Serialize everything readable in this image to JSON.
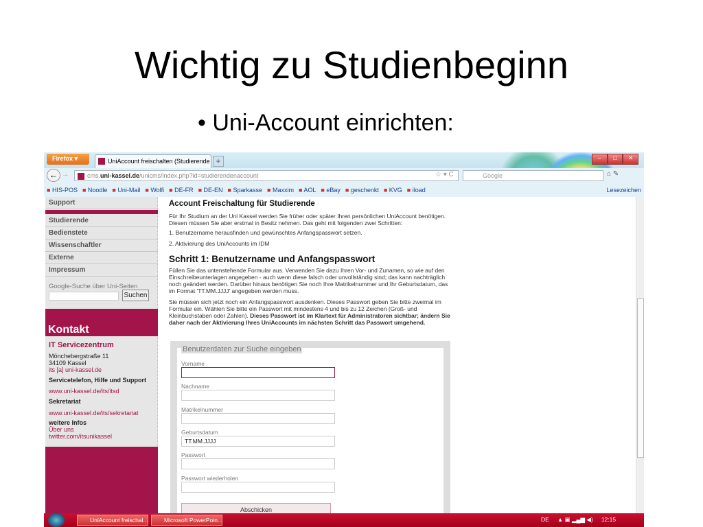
{
  "slide": {
    "title": "Wichtig zu Studienbeginn",
    "bullet": "Uni-Account einrichten:"
  },
  "browser": {
    "firefox_button": "Firefox ▾",
    "tab_title": "UniAccount freischalten (Studierende de...",
    "new_tab": "+",
    "url_prefix": "cms.",
    "url_domain": "uni-kassel.de",
    "url_path": "/unicms/index.php?id=studierendenaccount",
    "search_placeholder": "Google",
    "bookmarks": [
      "HIS-POS",
      "Noodle",
      "Uni-Mail",
      "Wolfi",
      "DE-FR",
      "DE-EN",
      "Sparkasse",
      "Maxxim",
      "AOL",
      "eBay",
      "geschenkt",
      "KVG",
      "iload"
    ],
    "bookmarks_right": "Lesezeichen"
  },
  "sidebar": {
    "items": [
      "Support",
      "Studierende",
      "Bedienstete",
      "Wissenschaftler",
      "Externe",
      "Impressum"
    ],
    "google_label": "Google-Suche über Uni-Seiten",
    "search_button": "Suchen",
    "kontakt": "Kontakt",
    "org": "IT Servicezentrum",
    "street": "Mönchebergstraße 11",
    "city": "34109 Kassel",
    "email": "its [a] uni-kassel.de",
    "service_heading": "Servicetelefon, Hilfe und Support",
    "service_link": "www.uni-kassel.de/its/itsd",
    "sekretariat_heading": "Sekretariat",
    "sekretariat_link": "www.uni-kassel.de/its/sekretariat",
    "infos_heading": "weitere Infos",
    "about_link": "Über uns",
    "twitter_link": "twitter.com/itsunikassel"
  },
  "main": {
    "heading": "Account Freischaltung für Studierende",
    "intro": "Für Ihr Studium an der Uni Kassel werden Sie früher oder später Ihren persönlichen UniAccount benötigen. Diesen müssen Sie aber erstmal in Besitz nehmen. Das geht mit folgenden zwei Schritten:",
    "steps": [
      "1.  Benutzername herausfinden und gewünschtes Anfangspasswort setzen.",
      "2.  Aktivierung des UniAccounts im IDM"
    ],
    "step1_heading": "Schritt 1: Benutzername und Anfangspasswort",
    "para1": "Füllen Sie das untenstehende Formular aus. Verwenden Sie dazu Ihren Vor- und Zunamen, so wie auf den Einschreibeunterlagen angegeben - auch wenn diese falsch oder unvollständig sind; das kann nachträglich noch geändert werden. Darüber hinaus benötigen Sie noch Ihre Matrikelnummer und Ihr Geburtsdatum, das im Format 'TT.MM.JJJJ' angegeben werden muss.",
    "para2": "Sie müssen sich jetzt noch ein Anfangspasswort ausdenken. Dieses Passwort geben Sie bitte zweimal im Formular ein. Wählen Sie bitte ein Passwort mit mindestens 4 und bis zu 12 Zeichen (Groß- und Kleinbuchstaben oder Zahlen). ",
    "para2_bold": "Dieses Passwort ist im Klartext für Administratoren sichtbar; ändern Sie daher nach der Aktivierung Ihres UniAccounts im nächsten Schritt das Passwort umgehend."
  },
  "form": {
    "legend": "Benutzerdaten zur Suche eingeben",
    "fields": [
      {
        "label": "Vorname",
        "value": ""
      },
      {
        "label": "Nachname",
        "value": ""
      },
      {
        "label": "Matrikelnummer",
        "value": ""
      },
      {
        "label": "Geburtsdatum",
        "value": "TT.MM.JJJJ"
      },
      {
        "label": "Passwort",
        "value": ""
      },
      {
        "label": "Passwort wiederholen",
        "value": ""
      }
    ],
    "submit": "Abschicken"
  },
  "taskbar": {
    "tasks": [
      "UniAccount freischal...",
      "Microsoft PowerPoin..."
    ],
    "lang": "DE",
    "time": "12:15"
  }
}
